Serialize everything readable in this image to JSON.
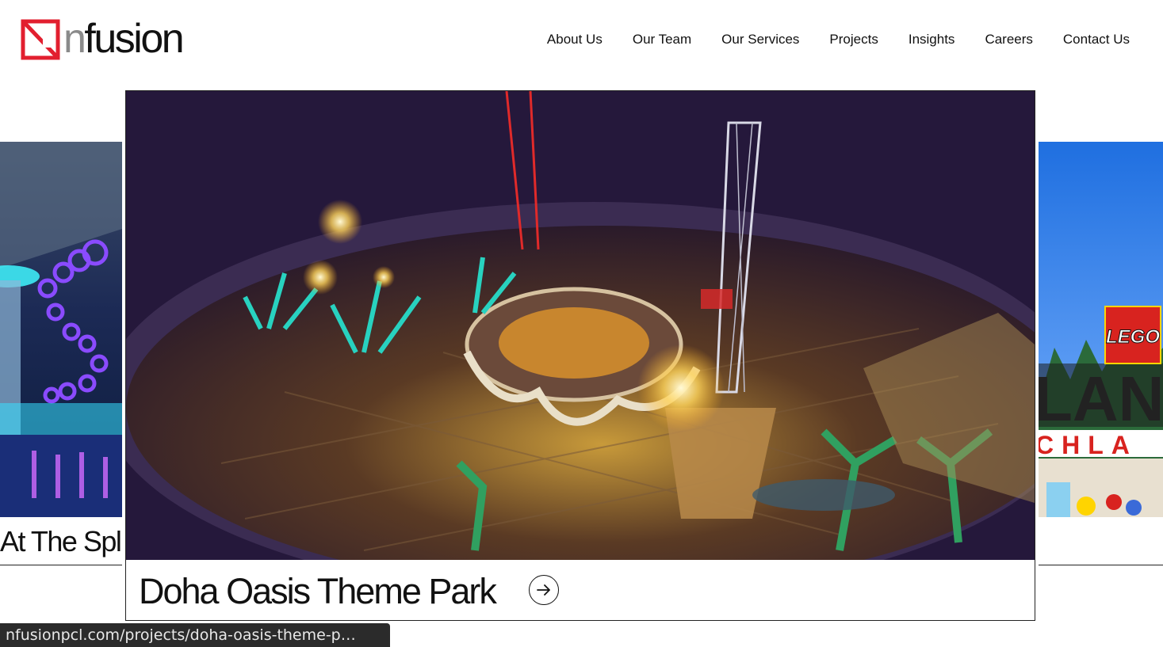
{
  "brand": {
    "name_prefix": "n",
    "name_rest": "fusion",
    "accent_color": "#e21f2f"
  },
  "nav": {
    "items": [
      "About Us",
      "Our Team",
      "Our Services",
      "Projects",
      "Insights",
      "Careers",
      "Contact Us"
    ]
  },
  "carousel": {
    "previous_title": "At The Spl",
    "current_title": "Doha Oasis Theme Park",
    "current_image_alt": "Doha Oasis Theme Park rendering",
    "next_image_alt": "LEGOLAND entrance",
    "next_sign_text": "LEGO",
    "next_letters_top": "LAN",
    "next_letters_bottom": "CHLA"
  },
  "status_bar": {
    "url": "nfusionpcl.com/projects/doha-oasis-theme-p…"
  }
}
